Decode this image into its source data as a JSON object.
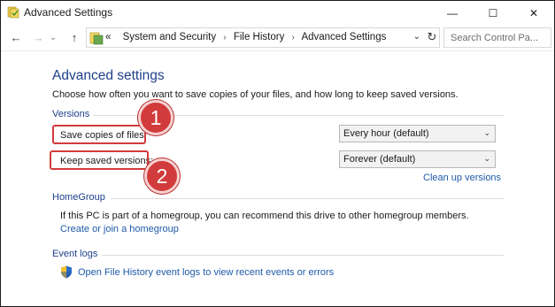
{
  "window": {
    "title": "Advanced Settings",
    "minimize_glyph": "—",
    "maximize_glyph": "☐",
    "close_glyph": "✕"
  },
  "nav": {
    "back_glyph": "←",
    "forward_glyph": "→",
    "recent_glyph": "⌄",
    "up_glyph": "↑",
    "breadcrumb_prefix": "«",
    "breadcrumbs": [
      "System and Security",
      "File History",
      "Advanced Settings"
    ],
    "separator": "›",
    "dropdown_glyph": "⌄",
    "refresh_glyph": "↻",
    "search_placeholder": "Search Control Pa..."
  },
  "page": {
    "title": "Advanced settings",
    "description": "Choose how often you want to save copies of your files, and how long to keep saved versions."
  },
  "versions": {
    "heading": "Versions",
    "save_copies_label": "Save copies of files:",
    "save_copies_value": "Every hour (default)",
    "keep_versions_label": "Keep saved versions:",
    "keep_versions_value": "Forever (default)",
    "clean_up_link": "Clean up versions"
  },
  "homegroup": {
    "heading": "HomeGroup",
    "text": "If this PC is part of a homegroup, you can recommend this drive to other homegroup members.",
    "link": "Create or join a homegroup"
  },
  "event_logs": {
    "heading": "Event logs",
    "link": "Open File History event logs to view recent events or errors"
  },
  "annotations": {
    "badge_1": "1",
    "badge_2": "2"
  },
  "colors": {
    "heading_blue": "#1e3f8a",
    "link_blue": "#1e5aa8",
    "annotation_red": "#d23b3b"
  }
}
